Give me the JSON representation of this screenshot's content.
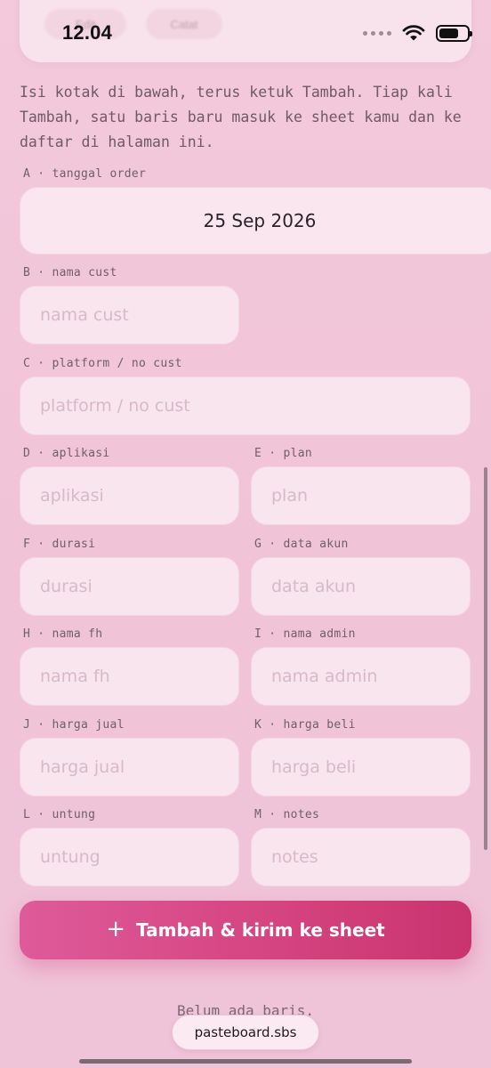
{
  "status_bar": {
    "time": "12.04"
  },
  "header": {
    "ghost_buttons": [
      "Edit",
      "Catat"
    ]
  },
  "intro": "Isi kotak di bawah, terus ketuk Tambah. Tiap kali Tambah, satu baris baru masuk ke sheet kamu dan ke daftar di halaman ini.",
  "fields": {
    "a": {
      "label": "A · tanggal order",
      "value": "25 Sep 2026"
    },
    "b": {
      "label": "B · nama cust",
      "placeholder": "nama cust"
    },
    "c": {
      "label": "C · platform / no cust",
      "placeholder": "platform / no cust"
    },
    "d": {
      "label": "D · aplikasi",
      "placeholder": "aplikasi"
    },
    "e": {
      "label": "E · plan",
      "placeholder": "plan"
    },
    "f": {
      "label": "F · durasi",
      "placeholder": "durasi"
    },
    "g": {
      "label": "G · data akun",
      "placeholder": "data akun"
    },
    "h": {
      "label": "H · nama fh",
      "placeholder": "nama fh"
    },
    "i": {
      "label": "I · nama admin",
      "placeholder": "nama admin"
    },
    "j": {
      "label": "J · harga jual",
      "placeholder": "harga jual"
    },
    "k": {
      "label": "K · harga beli",
      "placeholder": "harga beli"
    },
    "l": {
      "label": "L · untung",
      "placeholder": "untung"
    },
    "m": {
      "label": "M · notes",
      "placeholder": "notes"
    }
  },
  "submit": {
    "icon": "plus-icon",
    "label": "Tambah & kirim ke sheet"
  },
  "empty_state": "Belum ada baris.",
  "browser": {
    "url": "pasteboard.sbs"
  },
  "colors": {
    "accent": "#d4437f",
    "background": "#f1c3d7",
    "field": "#f9e5ee"
  }
}
